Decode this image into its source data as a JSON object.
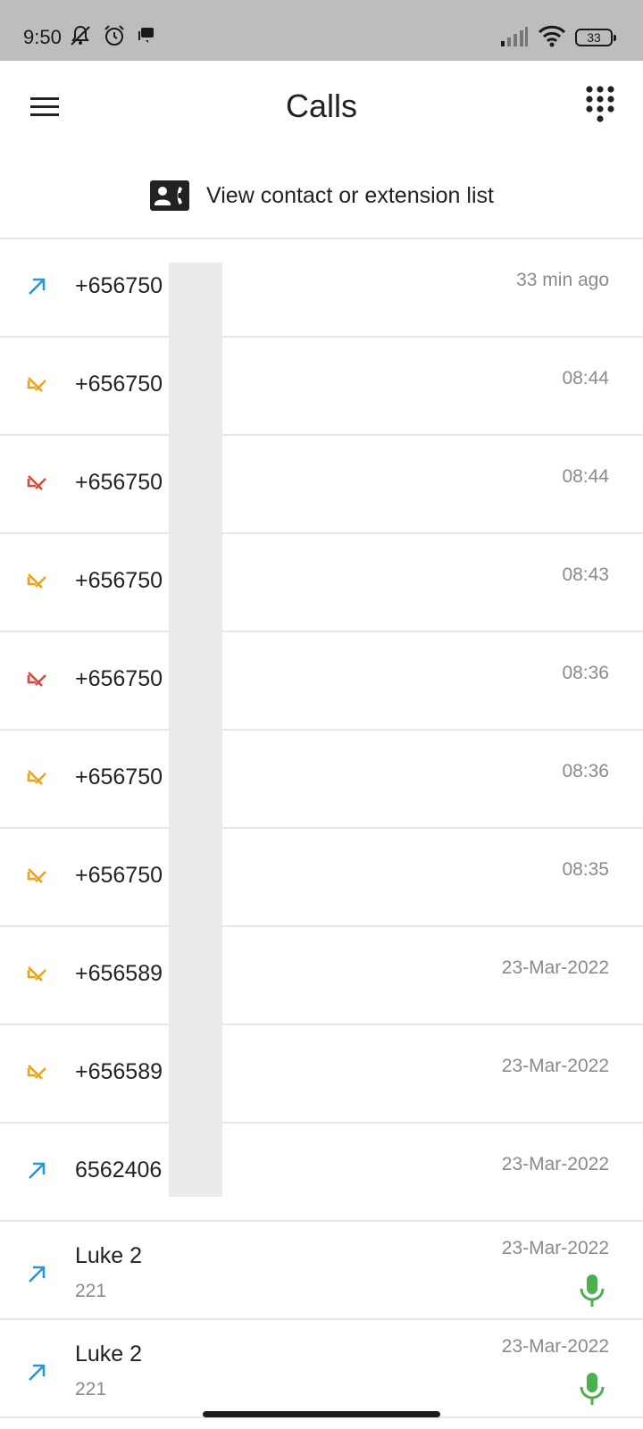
{
  "status_bar": {
    "time": "9:50",
    "icons": [
      "mute-icon",
      "alarm-icon",
      "message-icon",
      "signal-icon",
      "wifi-icon"
    ],
    "battery": "33"
  },
  "header": {
    "title": "Calls",
    "menu_icon": "hamburger-menu-icon",
    "dialpad_icon": "dialpad-icon"
  },
  "contacts_link": {
    "icon": "contact-card-icon",
    "label": "View contact or extension list"
  },
  "colors": {
    "outgoing": "#2a96d4",
    "incoming": "#f2a116",
    "missed": "#e0473c",
    "recording": "#4caf50"
  },
  "calls": [
    {
      "type": "outgoing",
      "number": "+656750",
      "time": "33 min ago"
    },
    {
      "type": "incoming",
      "number": "+656750",
      "time": "08:44"
    },
    {
      "type": "missed",
      "number": "+656750",
      "time": "08:44"
    },
    {
      "type": "incoming",
      "number": "+656750",
      "time": "08:43"
    },
    {
      "type": "missed",
      "number": "+656750",
      "time": "08:36"
    },
    {
      "type": "incoming",
      "number": "+656750",
      "time": "08:36"
    },
    {
      "type": "incoming",
      "number": "+656750",
      "time": "08:35"
    },
    {
      "type": "incoming",
      "number": "+656589",
      "time": "23-Mar-2022"
    },
    {
      "type": "incoming",
      "number": "+656589",
      "time": "23-Mar-2022"
    },
    {
      "type": "outgoing",
      "number": "6562406",
      "time": "23-Mar-2022"
    },
    {
      "type": "outgoing",
      "number": "Luke 2",
      "extension": "221",
      "time": "23-Mar-2022",
      "recording": true
    },
    {
      "type": "outgoing",
      "number": "Luke 2",
      "extension": "221",
      "time": "23-Mar-2022",
      "recording": true
    }
  ]
}
